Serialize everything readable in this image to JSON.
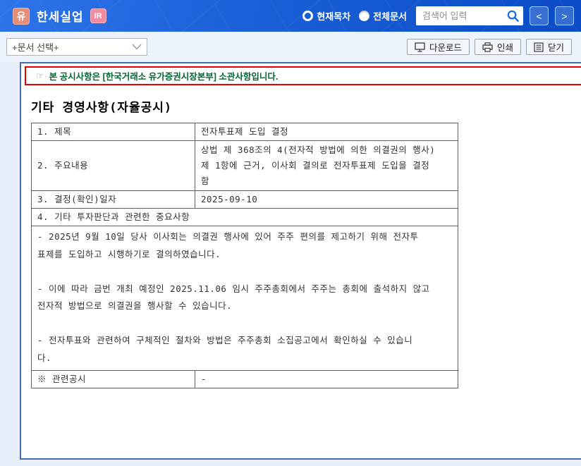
{
  "colors": {
    "page-bg": "#e8effb",
    "accent-red": "#e80000",
    "accent-green": "#006633",
    "doc-border": "#3f6fb2",
    "badge-market": "#e78d77",
    "badge-ir": "#f08ba2",
    "header-blue": "#1a5fd6"
  },
  "header": {
    "market_badge": "유",
    "company_name": "한세실업",
    "ir_badge": "IR",
    "radio_current_label": "현재목차",
    "radio_all_label": "전체문서",
    "search_placeholder": "검색어 입력",
    "prev_glyph": "<",
    "next_glyph": ">"
  },
  "toolbar": {
    "doc_select_value": "+문서 선택+",
    "download_label": "다운로드",
    "print_label": "인쇄",
    "close_label": "닫기"
  },
  "notice": {
    "pointer_glyph": "☞",
    "text": "본 공시사항은 [한국거래소 유가증권시장본부] 소관사항입니다."
  },
  "document": {
    "title": "기타 경영사항(자율공시)",
    "table": {
      "rows": [
        {
          "label": "1. 제목",
          "value": "전자투표제 도입 결정"
        },
        {
          "label": "2. 주요내용",
          "value": "상법 제 368조의 4(전자적 방법에 의한 의결권의 행사)\n제 1항에 근거, 이사회 결의로 전자투표제 도입을 결정\n함"
        },
        {
          "label": "3. 결정(확인)일자",
          "value": "2025-09-10"
        },
        {
          "full": "4. 기타 투자판단과 관련한 중요사항"
        },
        {
          "full": "- 2025년 9월 10일 당사 이사회는 의결권 행사에 있어 주주 편의를 제고하기 위해 전자투\n표제를 도입하고 시행하기로 결의하였습니다.\n\n- 이에 따라 금번 개최 예정인 2025.11.06 임시 주주총회에서 주주는 총회에 출석하지 않고\n전자적 방법으로 의결권을 행사할 수 있습니다.\n\n- 전자투표와 관련하여 구체적인 절차와 방법은 주주총회 소집공고에서 확인하실 수 있습니\n다."
        },
        {
          "label": "※ 관련공시",
          "value": "-"
        }
      ]
    }
  }
}
